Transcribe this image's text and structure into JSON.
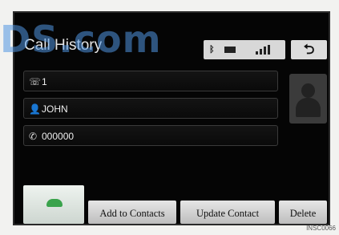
{
  "watermark": {
    "text": "DS.com"
  },
  "header": {
    "title": "Call History",
    "back_icon": "back-arrow-icon",
    "status_icons": [
      "bluetooth-icon",
      "battery-icon",
      "signal-icon"
    ]
  },
  "fields": {
    "number_label": "1",
    "name": "JOHN",
    "phone": "000000"
  },
  "buttons": {
    "add_to_contacts": "Add to Contacts",
    "update_contact": "Update Contact",
    "delete": "Delete",
    "call_icon": "phone-handset-icon"
  },
  "footer": {
    "code": "INSC0066"
  }
}
